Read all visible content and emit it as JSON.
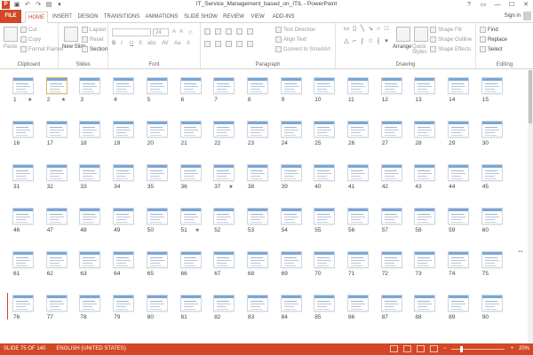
{
  "window": {
    "title": "IT_Service_Management_based_on_ITIL - PowerPoint",
    "app_icon_label": "P",
    "controls": [
      "?",
      "▭",
      "—",
      "☐",
      "✕"
    ]
  },
  "tabs": {
    "file": "FILE",
    "items": [
      "HOME",
      "INSERT",
      "DESIGN",
      "TRANSITIONS",
      "ANIMATIONS",
      "SLIDE SHOW",
      "REVIEW",
      "VIEW",
      "ADD-INS"
    ],
    "signin": "Sign in"
  },
  "ribbon": {
    "clipboard": {
      "paste": "Paste",
      "cut": "Cut",
      "copy": "Copy",
      "format_painter": "Format Painter",
      "label": "Clipboard"
    },
    "slides": {
      "new_slide": "New Slide",
      "layout": "Layout",
      "reset": "Reset",
      "section": "Section",
      "label": "Slides"
    },
    "font": {
      "size": "24",
      "label": "Font"
    },
    "paragraph": {
      "text_direction": "Text Direction",
      "align_text": "Align Text",
      "convert_smartart": "Convert to SmartArt",
      "label": "Paragraph"
    },
    "drawing": {
      "arrange": "Arrange",
      "quick_styles": "Quick Styles",
      "shape_fill": "Shape Fill",
      "shape_outline": "Shape Outline",
      "shape_effects": "Shape Effects",
      "label": "Drawing"
    },
    "editing": {
      "find": "Find",
      "replace": "Replace",
      "select": "Select",
      "label": "Editing"
    }
  },
  "slides": [
    {
      "n": "1",
      "star": "★"
    },
    {
      "n": "2",
      "star": "★"
    },
    {
      "n": "3"
    },
    {
      "n": "4"
    },
    {
      "n": "5"
    },
    {
      "n": "6"
    },
    {
      "n": "7"
    },
    {
      "n": "8"
    },
    {
      "n": "9"
    },
    {
      "n": "10"
    },
    {
      "n": "11"
    },
    {
      "n": "12"
    },
    {
      "n": "13"
    },
    {
      "n": "14"
    },
    {
      "n": "15"
    },
    {
      "n": "16"
    },
    {
      "n": "17"
    },
    {
      "n": "18"
    },
    {
      "n": "19"
    },
    {
      "n": "20"
    },
    {
      "n": "21"
    },
    {
      "n": "22"
    },
    {
      "n": "23"
    },
    {
      "n": "24"
    },
    {
      "n": "25"
    },
    {
      "n": "26"
    },
    {
      "n": "27"
    },
    {
      "n": "28"
    },
    {
      "n": "29"
    },
    {
      "n": "30"
    },
    {
      "n": "31"
    },
    {
      "n": "32"
    },
    {
      "n": "33"
    },
    {
      "n": "34"
    },
    {
      "n": "35"
    },
    {
      "n": "36"
    },
    {
      "n": "37",
      "star": "★"
    },
    {
      "n": "38"
    },
    {
      "n": "39"
    },
    {
      "n": "40"
    },
    {
      "n": "41"
    },
    {
      "n": "42"
    },
    {
      "n": "43"
    },
    {
      "n": "44"
    },
    {
      "n": "45"
    },
    {
      "n": "46"
    },
    {
      "n": "47"
    },
    {
      "n": "48"
    },
    {
      "n": "49"
    },
    {
      "n": "50"
    },
    {
      "n": "51",
      "star": "★"
    },
    {
      "n": "52"
    },
    {
      "n": "53"
    },
    {
      "n": "54"
    },
    {
      "n": "55"
    },
    {
      "n": "56"
    },
    {
      "n": "57"
    },
    {
      "n": "58"
    },
    {
      "n": "59"
    },
    {
      "n": "60"
    },
    {
      "n": "61"
    },
    {
      "n": "62"
    },
    {
      "n": "63"
    },
    {
      "n": "64"
    },
    {
      "n": "65"
    },
    {
      "n": "66"
    },
    {
      "n": "67"
    },
    {
      "n": "68"
    },
    {
      "n": "69"
    },
    {
      "n": "70"
    },
    {
      "n": "71"
    },
    {
      "n": "72"
    },
    {
      "n": "73"
    },
    {
      "n": "74"
    },
    {
      "n": "75"
    },
    {
      "n": "76"
    },
    {
      "n": "77"
    },
    {
      "n": "78"
    },
    {
      "n": "79"
    },
    {
      "n": "80"
    },
    {
      "n": "81"
    },
    {
      "n": "82"
    },
    {
      "n": "83"
    },
    {
      "n": "84"
    },
    {
      "n": "85"
    },
    {
      "n": "86"
    },
    {
      "n": "87"
    },
    {
      "n": "88"
    },
    {
      "n": "89"
    },
    {
      "n": "90"
    }
  ],
  "status": {
    "slide": "SLIDE 75 OF 140",
    "language": "ENGLISH (UNITED STATES)",
    "zoom": "20%"
  },
  "colors": {
    "accent": "#d24726"
  }
}
